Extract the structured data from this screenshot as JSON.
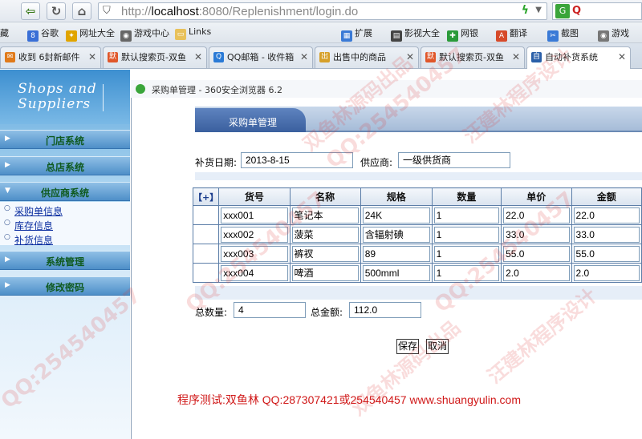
{
  "browser": {
    "url_prefix": "http://",
    "url_host": "localhost",
    "url_rest": ":8080/Replenishment/login.do",
    "bookmarks": [
      "藏",
      "谷歌",
      "网址大全",
      "游戏中心",
      "Links",
      "扩展",
      "影视大全",
      "网银",
      "翻译",
      "截图",
      "游戏"
    ],
    "tabs": [
      {
        "label": "收到 6封新邮件",
        "icon_color": "#e07a1a"
      },
      {
        "label": "默认搜索页-双鱼",
        "icon_color": "#e0572a"
      },
      {
        "label": "QQ邮箱 - 收件箱",
        "icon_color": "#2a7ad6"
      },
      {
        "label": "出售中的商品",
        "icon_color": "#d6a02a"
      },
      {
        "label": "默认搜索页-双鱼",
        "icon_color": "#e0572a"
      },
      {
        "label": "自动补货系统",
        "icon_color": "#2a5fa8"
      }
    ]
  },
  "sidebar": {
    "brand_line1": "Shops and",
    "brand_line2": "Suppliers",
    "menus": [
      {
        "label": "门店系统"
      },
      {
        "label": "总店系统"
      },
      {
        "label": "供应商系统"
      },
      {
        "label": "系统管理"
      },
      {
        "label": "修改密码"
      }
    ],
    "submenu": [
      "采购单信息",
      "库存信息",
      "补货信息"
    ]
  },
  "dialog": {
    "window_title": "采购单管理 - 360安全浏览器 6.2",
    "section_title": "采购单管理",
    "date_label": "补货日期:",
    "date_value": "2013-8-15",
    "supplier_label": "供应商:",
    "supplier_value": "一级供货商",
    "table": {
      "add_label": "【+】",
      "headers": [
        "货号",
        "名称",
        "规格",
        "数量",
        "单价",
        "金额"
      ],
      "rows": [
        [
          "xxx001",
          "笔记本",
          "24K",
          "1",
          "22.0",
          "22.0"
        ],
        [
          "xxx002",
          "菠菜",
          "含辐射碘",
          "1",
          "33.0",
          "33.0"
        ],
        [
          "xxx003",
          "裤衩",
          "89",
          "1",
          "55.0",
          "55.0"
        ],
        [
          "xxx004",
          "啤酒",
          "500mml",
          "1",
          "2.0",
          "2.0"
        ]
      ]
    },
    "total_qty_label": "总数量:",
    "total_qty_value": "4",
    "total_amount_label": "总金额:",
    "total_amount_value": "112.0",
    "save_label": "保存",
    "cancel_label": "取消"
  },
  "footer": "程序测试:双鱼林 QQ:287307421或254540457 www.shuangyulin.com",
  "watermarks": [
    "QQ:254540457",
    "双鱼林源码出品",
    "汪建林程序设计",
    "QQ:254540457",
    "QQ:254540457",
    "双鱼林源码出品",
    "汪建林程序设计",
    "QQ:254540457"
  ]
}
